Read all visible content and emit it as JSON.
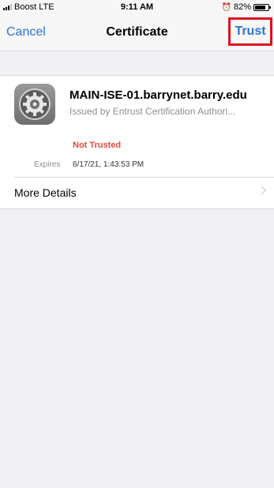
{
  "status_bar": {
    "carrier": "Boost",
    "network": "LTE",
    "time": "9:11 AM",
    "battery_percent": "82%",
    "battery_level": 0.82
  },
  "nav": {
    "cancel_label": "Cancel",
    "title": "Certificate",
    "trust_label": "Trust"
  },
  "certificate": {
    "icon": "gear-icon",
    "name": "MAIN-ISE-01.barrynet.barry.edu",
    "issuer": "Issued by Entrust Certification Authori...",
    "trust_status": "Not Trusted",
    "expires_label": "Expires",
    "expires_value": "6/17/21, 1:43:53 PM"
  },
  "more_details": {
    "label": "More Details"
  },
  "colors": {
    "accent": "#2a74d6",
    "warning": "#e0483b",
    "highlight_border": "#e0101e"
  }
}
